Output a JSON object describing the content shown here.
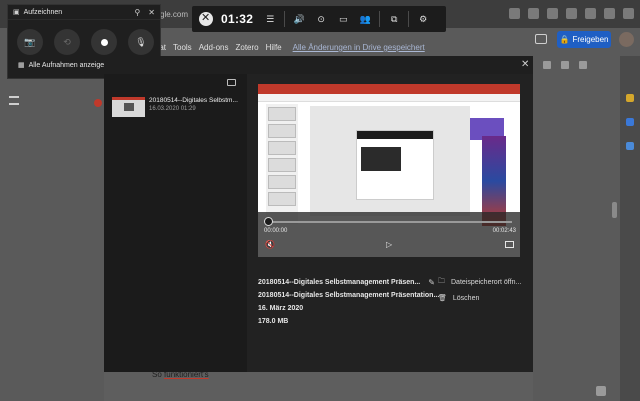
{
  "browser": {
    "url_fragment": "gle.com"
  },
  "docs": {
    "menus": [
      "rmat",
      "Tools",
      "Add-ons",
      "Zotero",
      "Hilfe"
    ],
    "save_status": "Alle Änderungen in Drive gespeichert",
    "share_label": "Freigeben",
    "body_text_start": "So ",
    "body_text_link": "funktioniert's"
  },
  "capture_widget": {
    "title": "Aufzeichnen",
    "show_all_label": "Alle Aufnahmen anzeigen"
  },
  "game_bar": {
    "timer": "01:32"
  },
  "gallery": {
    "items": [
      {
        "name": "20180514--Digitales Selbstm...",
        "date": "16.03.2020 01:29"
      }
    ],
    "player": {
      "elapsed": "00:00:00",
      "duration": "00:02:43"
    },
    "details": {
      "title_short": "20180514--Digitales Selbstmanagement Präsen...",
      "title_full": "20180514--Digitales Selbstmanagement Präsentation...",
      "date": "16. März 2020",
      "size": "178.0 MB"
    },
    "actions": {
      "open_location": "Dateispeicherort öffn...",
      "delete": "Löschen"
    }
  },
  "colors": {
    "share_button": "#1f5fc4",
    "panel_bg": "#1f1f1f",
    "ribbon_red": "#c0392b"
  }
}
